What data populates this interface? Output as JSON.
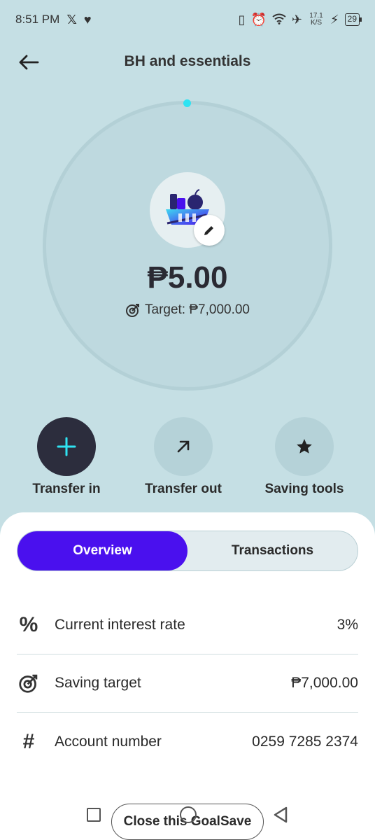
{
  "status_bar": {
    "time": "8:51 PM",
    "left_icons": [
      "x-icon",
      "heart-icon"
    ],
    "network_speed": "17.1 K/S",
    "battery": "29"
  },
  "header": {
    "title": "BH and essentials",
    "back_icon": "arrow-left-icon"
  },
  "goal": {
    "icon": "grocery-basket-icon",
    "edit_icon": "pencil-icon",
    "balance": "₱5.00",
    "target_label": "Target: ₱7,000.00",
    "target_icon": "target-icon",
    "progress_dot_color": "#2fe3f2"
  },
  "actions": [
    {
      "label": "Transfer in",
      "icon": "plus-icon"
    },
    {
      "label": "Transfer out",
      "icon": "arrow-up-right-icon"
    },
    {
      "label": "Saving tools",
      "icon": "star-icon"
    }
  ],
  "tabs": {
    "overview": "Overview",
    "transactions": "Transactions",
    "active_color": "#4a10ee"
  },
  "details": [
    {
      "icon": "percent-icon",
      "label": "Current interest rate",
      "value": "3%"
    },
    {
      "icon": "target-icon",
      "label": "Saving target",
      "value": "₱7,000.00"
    },
    {
      "icon": "hash-icon",
      "label": "Account number",
      "value": "0259 7285 2374"
    }
  ],
  "close_button": "Close this GoalSave"
}
